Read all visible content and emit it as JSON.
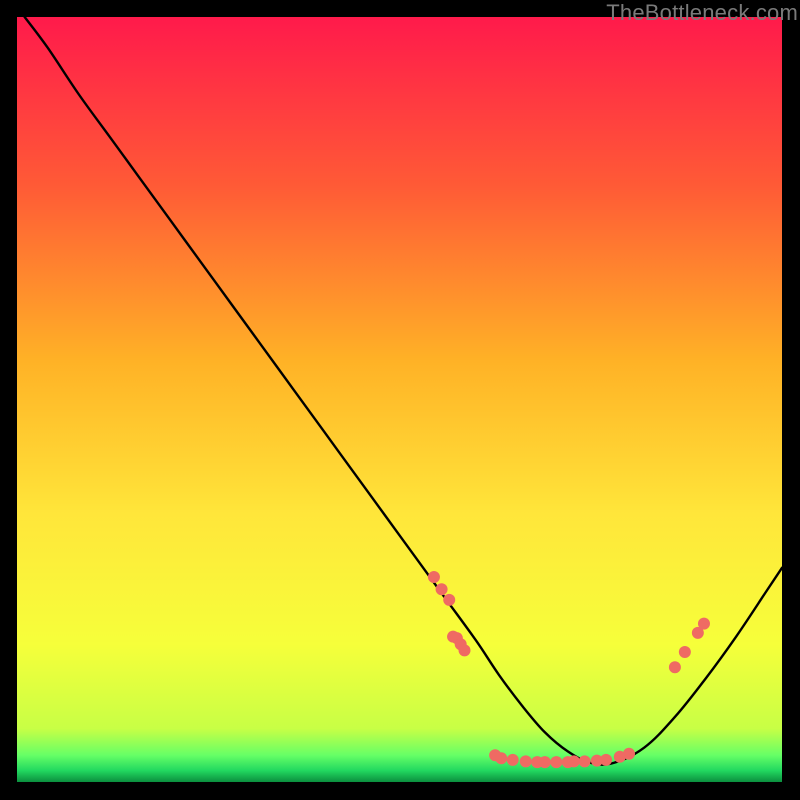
{
  "watermark": "TheBottleneck.com",
  "chart_data": {
    "type": "line",
    "title": "",
    "xlabel": "",
    "ylabel": "",
    "xlim": [
      0,
      100
    ],
    "ylim": [
      0,
      100
    ],
    "background_gradient": {
      "top": "#ff1a4b",
      "mid_upper": "#ff7a2a",
      "mid": "#ffe63a",
      "lower": "#f2ff3a",
      "green": "#2dff6e",
      "bottom": "#0b8f3e"
    },
    "series": [
      {
        "name": "bottleneck-curve",
        "color": "#000000",
        "x": [
          1,
          4,
          8,
          12,
          16,
          20,
          24,
          28,
          32,
          36,
          40,
          44,
          48,
          52,
          56,
          60,
          63,
          66,
          69,
          72,
          75,
          78,
          82,
          86,
          90,
          94,
          98,
          100
        ],
        "y": [
          100,
          96,
          90,
          84.5,
          79,
          73.5,
          68,
          62.5,
          57,
          51.5,
          46,
          40.5,
          35,
          29.5,
          24,
          18.5,
          14,
          10,
          6.5,
          4,
          2.5,
          2.5,
          4.5,
          8.5,
          13.5,
          19,
          25,
          28
        ]
      }
    ],
    "scatter": {
      "name": "highlighted-points",
      "color": "#ef6a63",
      "radius": 6,
      "points": [
        {
          "x": 54.5,
          "y": 26.8
        },
        {
          "x": 55.5,
          "y": 25.2
        },
        {
          "x": 56.5,
          "y": 23.8
        },
        {
          "x": 57.0,
          "y": 19.0
        },
        {
          "x": 57.5,
          "y": 18.8
        },
        {
          "x": 58.0,
          "y": 18.0
        },
        {
          "x": 58.5,
          "y": 17.2
        },
        {
          "x": 62.5,
          "y": 3.5
        },
        {
          "x": 63.3,
          "y": 3.1
        },
        {
          "x": 64.8,
          "y": 2.9
        },
        {
          "x": 66.5,
          "y": 2.7
        },
        {
          "x": 68.0,
          "y": 2.6
        },
        {
          "x": 69.0,
          "y": 2.6
        },
        {
          "x": 70.5,
          "y": 2.6
        },
        {
          "x": 72.0,
          "y": 2.6
        },
        {
          "x": 72.8,
          "y": 2.7
        },
        {
          "x": 74.2,
          "y": 2.7
        },
        {
          "x": 75.8,
          "y": 2.8
        },
        {
          "x": 77.0,
          "y": 2.9
        },
        {
          "x": 78.8,
          "y": 3.3
        },
        {
          "x": 80.0,
          "y": 3.7
        },
        {
          "x": 86.0,
          "y": 15.0
        },
        {
          "x": 87.3,
          "y": 17.0
        },
        {
          "x": 89.0,
          "y": 19.5
        },
        {
          "x": 89.8,
          "y": 20.7
        }
      ]
    }
  }
}
